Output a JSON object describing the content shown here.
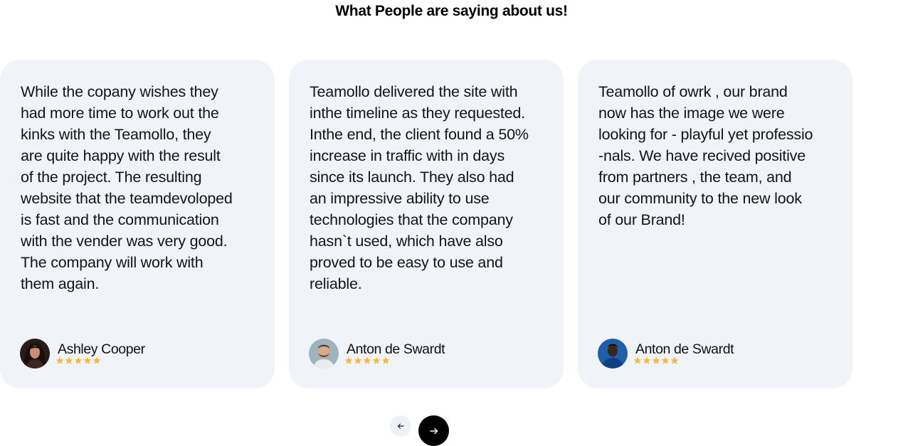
{
  "section": {
    "title": "What People are saying about us!"
  },
  "testimonials": [
    {
      "text": "While the copany wishes they\nhad more time to work out the\nkinks with the Teamollo, they\nare quite happy with the result\nof the project. The resulting\nwebsite that the teamdevoloped\nis fast and the communication\nwith the vender was very good.\nThe company will work with\nthem again.",
      "author": "Ashley Cooper",
      "rating": 5,
      "avatar": "woman-portrait"
    },
    {
      "text": "Teamollo delivered the site with\ninthe timeline as they requested.\nInthe end, the client found a 50%\nincrease in traffic with in days\nsince its launch. They also had\nan impressive ability to use\ntechnologies that the company\nhasn`t used, which have also\nproved to be easy to use and\nreliable.",
      "author": "Anton de Swardt",
      "rating": 5,
      "avatar": "bearded-man-portrait"
    },
    {
      "text": "Teamollo of owrk , our brand\nnow has the image we were\nlooking for - playful yet professio\n-nals. We have recived positive\nfrom partners , the team, and\nour community to the new look\nof our Brand!",
      "author": "Anton de Swardt",
      "rating": 5,
      "avatar": "man-blue-background-portrait"
    }
  ],
  "navigation": {
    "prev_icon": "arrow-left-icon",
    "next_icon": "arrow-right-icon"
  },
  "colors": {
    "card_background": "#f0f4f8",
    "star": "#f5b93e",
    "next_button": "#000000",
    "prev_button": "#eef2f6"
  }
}
